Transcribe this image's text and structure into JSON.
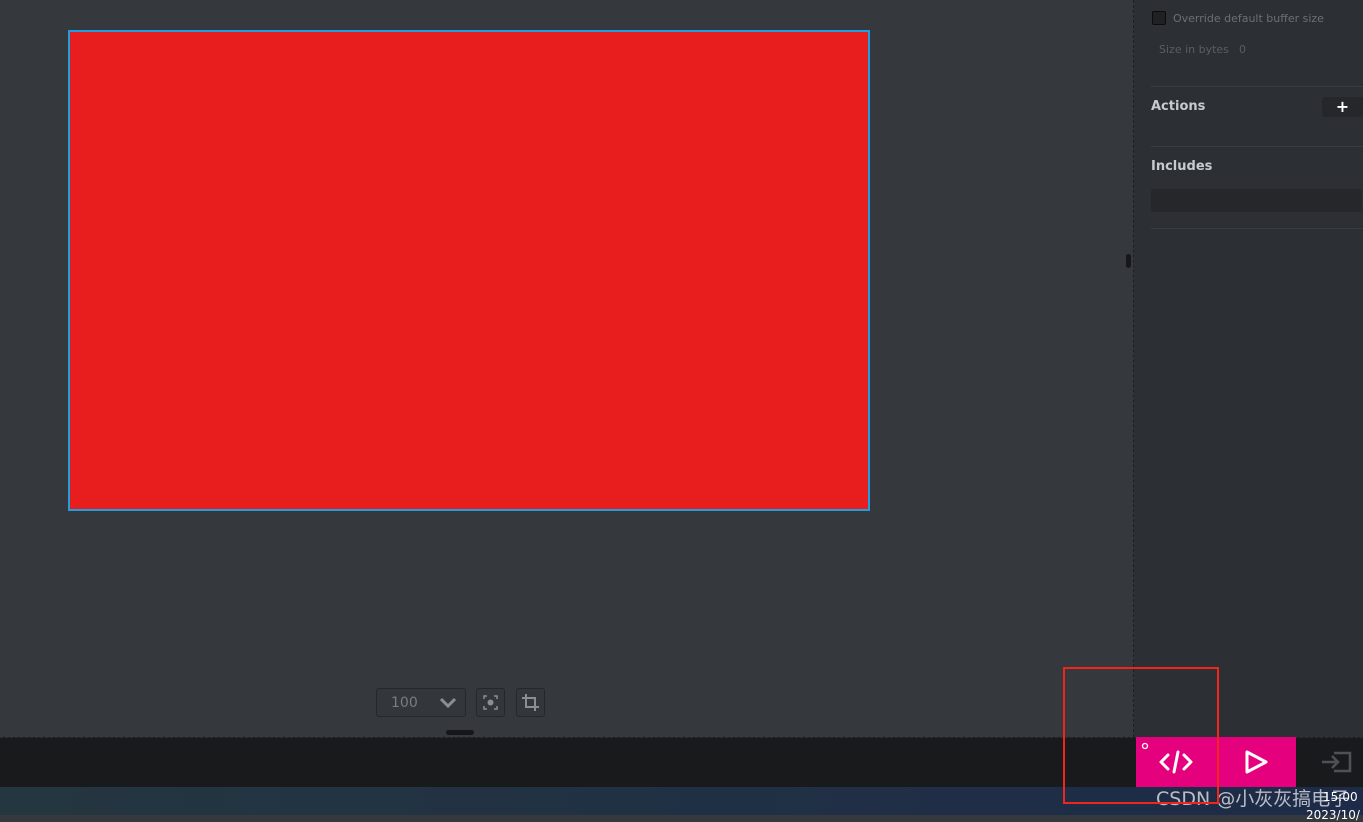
{
  "canvas": {
    "rect_color": "#e81e1e",
    "selection_color": "#1f9fe0"
  },
  "panel": {
    "override_buffer_label": "Override default buffer size",
    "override_buffer_checked": false,
    "size_label": "Size in bytes",
    "size_value": "0",
    "actions_title": "Actions",
    "add_action_icon": "plus-icon",
    "includes_title": "Includes"
  },
  "zoom_toolbar": {
    "zoom_value": "100",
    "center_icon": "focus-icon",
    "crop_icon": "crop-icon"
  },
  "bottom_bar": {
    "accent_color": "#e5007e",
    "code_button_icon": "code-icon",
    "run_button_icon": "play-icon",
    "export_icon": "sign-in-icon"
  },
  "taskbar": {
    "time": "15:00",
    "date": "2023/10/"
  },
  "watermark": "CSDN @小灰灰搞电子"
}
